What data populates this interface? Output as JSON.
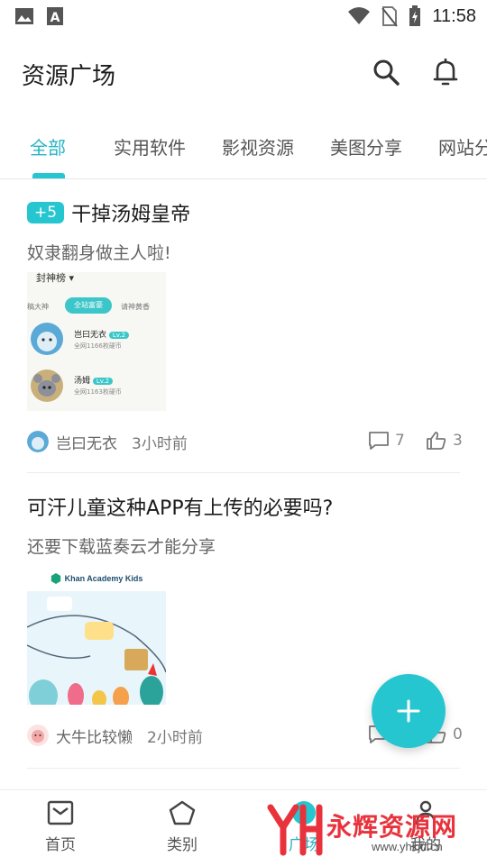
{
  "status_bar": {
    "time": "11:58"
  },
  "header": {
    "title": "资源广场"
  },
  "tabs": [
    {
      "label": "全部",
      "active": true
    },
    {
      "label": "实用软件"
    },
    {
      "label": "影视资源"
    },
    {
      "label": "美图分享"
    },
    {
      "label": "网站分"
    }
  ],
  "posts": [
    {
      "badge": "+5",
      "title": "干掉汤姆皇帝",
      "subtitle": "奴隶翻身做主人啦!",
      "thumbnail": {
        "header": "封神榜",
        "tabs": [
          "投稿大神",
          "全站富豪",
          "请神黄香"
        ],
        "rows": [
          {
            "name": "岂曰无衣",
            "level": "Lv.2",
            "detail": "全网1166枚硬币"
          },
          {
            "name": "汤姆",
            "level": "Lv.2",
            "detail": "全网1163枚硬币"
          }
        ]
      },
      "author": "岂曰无衣",
      "time": "3小时前",
      "comments": "7",
      "likes": "3"
    },
    {
      "title": "可汗儿童这种APP有上传的必要吗?",
      "subtitle": "还要下载蓝奏云才能分享",
      "thumbnail": {
        "brand": "Khan Academy Kids"
      },
      "author": "大牛比较懒",
      "time": "2小时前",
      "comments": "",
      "likes": "0"
    }
  ],
  "bottom_nav": [
    {
      "label": "首页",
      "icon": "inbox-icon"
    },
    {
      "label": "类别",
      "icon": "pentagon-icon"
    },
    {
      "label": "广场",
      "icon": "plaza-icon"
    },
    {
      "label": "我的",
      "icon": "person-icon"
    }
  ],
  "watermark": {
    "text": "永辉资源网",
    "url": "www.yhkjtf.cn"
  },
  "colors": {
    "accent": "#26c6d0",
    "watermark": "#e8323c"
  }
}
